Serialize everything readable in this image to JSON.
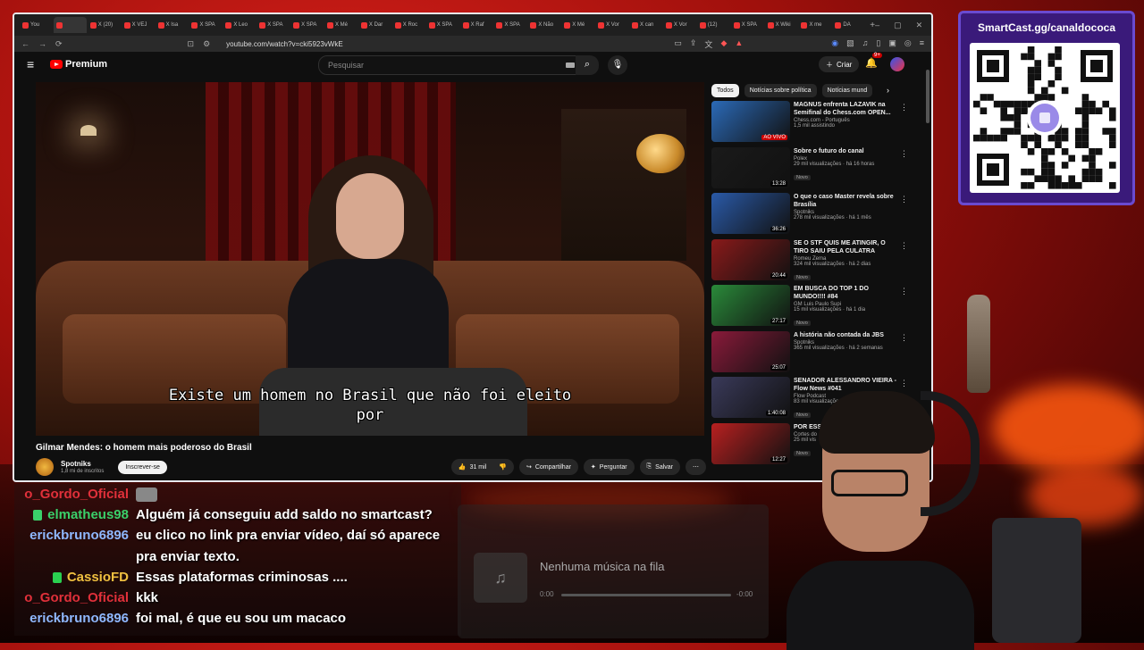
{
  "browser": {
    "tabs": [
      "You",
      "",
      "X (20)",
      "X VEJ",
      "X Isa",
      "X SPA",
      "X Leo",
      "X SPA",
      "X SPA",
      "X Mé",
      "X Dar",
      "X Roc",
      "X SPA",
      "X Raf",
      "X SPA",
      "X Não",
      "X Mé",
      "X Vor",
      "X can",
      "X Vor",
      "(12)",
      "X SPA",
      "X Wiki",
      "X me",
      "DA"
    ],
    "url": "youtube.com/watch?v=cki5923vWkE"
  },
  "youtube": {
    "logo_text": "Premium",
    "search_placeholder": "Pesquisar",
    "create_label": "Criar",
    "notif_count": "9+"
  },
  "video": {
    "subtitle_line1": "Existe um homem no Brasil que não foi eleito",
    "subtitle_line2": "por",
    "title": "Gilmar Mendes: o homem mais poderoso do Brasil",
    "channel": "Spotniks",
    "subscribers": "1,8 mi de inscritos",
    "subscribe_label": "Inscrever-se",
    "likes": "31 mil",
    "share_label": "Compartilhar",
    "ask_label": "Perguntar",
    "save_label": "Salvar"
  },
  "chips": [
    "Todos",
    "Notícias sobre política",
    "Notícias mund"
  ],
  "recommendations": [
    {
      "title": "MAGNUS enfrenta LAZAVIK na Semifinal do Chess.com OPEN...",
      "channel": "Chess.com - Português",
      "views": "1,5 mil assistindo",
      "duration": "AO VIVO",
      "live": true,
      "badge": "",
      "thumb": "#2b6ab8"
    },
    {
      "title": "Sobre o futuro do canal",
      "channel": "Polex",
      "views": "29 mil visualizações · há 16 horas",
      "duration": "13:28",
      "live": false,
      "badge": "Novo",
      "thumb": "#1a1a1a"
    },
    {
      "title": "O que o caso Master revela sobre Brasília",
      "channel": "Spotniks",
      "views": "278 mil visualizações · há 1 mês",
      "duration": "36:26",
      "live": false,
      "badge": "",
      "thumb": "#2a5aa8"
    },
    {
      "title": "SE O STF QUIS ME ATINGIR, O TIRO SAIU PELA CULATRA",
      "channel": "Romeu Zema",
      "views": "324 mil visualizações · há 2 dias",
      "duration": "20:44",
      "live": false,
      "badge": "Novo",
      "thumb": "#8a1a1a"
    },
    {
      "title": "EM BUSCA DO TOP 1 DO MUNDO!!!! #84",
      "channel": "GM Luis Paulo Supi",
      "views": "15 mil visualizações · há 1 dia",
      "duration": "27:17",
      "live": false,
      "badge": "Novo",
      "thumb": "#2a8a3a"
    },
    {
      "title": "A história não contada da JBS",
      "channel": "Spotniks",
      "views": "365 mil visualizações · há 2 semanas",
      "duration": "25:07",
      "live": false,
      "badge": "",
      "thumb": "#8a1a3a"
    },
    {
      "title": "SENADOR ALESSANDRO VIEIRA - Flow News #041",
      "channel": "Flow Podcast",
      "views": "83 mil visualizações",
      "duration": "1:40:08",
      "live": false,
      "badge": "Novo",
      "thumb": "#3a3a5a"
    },
    {
      "title": "POR ESSA EU NÃO ESPERAVA",
      "channel": "Cortes do",
      "views": "25 mil vis",
      "duration": "12:27",
      "live": false,
      "badge": "Novo",
      "thumb": "#b82020"
    }
  ],
  "qr": {
    "title": "SmartCast.gg/canaldococa"
  },
  "chat": [
    {
      "user": "o_Gordo_Oficial",
      "color": "#e0303a",
      "text": "",
      "badge": ""
    },
    {
      "user": "elmatheus98",
      "color": "#3ad06a",
      "text": "Alguém já conseguiu add saldo no smartcast?",
      "badge": "#3ad06a"
    },
    {
      "user": "erickbruno6896",
      "color": "#8fb8ff",
      "text": "eu clico no link pra enviar vídeo, daí só aparece",
      "badge": ""
    },
    {
      "user": "",
      "color": "#8fb8ff",
      "text": "pra enviar texto.",
      "badge": ""
    },
    {
      "user": "CassioFD",
      "color": "#f0c040",
      "text": "Essas plataformas criminosas ....",
      "badge": "#2ad050"
    },
    {
      "user": "o_Gordo_Oficial",
      "color": "#e0303a",
      "text": "kkk",
      "badge": ""
    },
    {
      "user": "erickbruno6896",
      "color": "#8fb8ff",
      "text": "foi mal, é que eu sou um macaco",
      "badge": ""
    }
  ],
  "music": {
    "title": "Nenhuma música na fila",
    "time_start": "0:00",
    "time_end": "-0:00"
  }
}
